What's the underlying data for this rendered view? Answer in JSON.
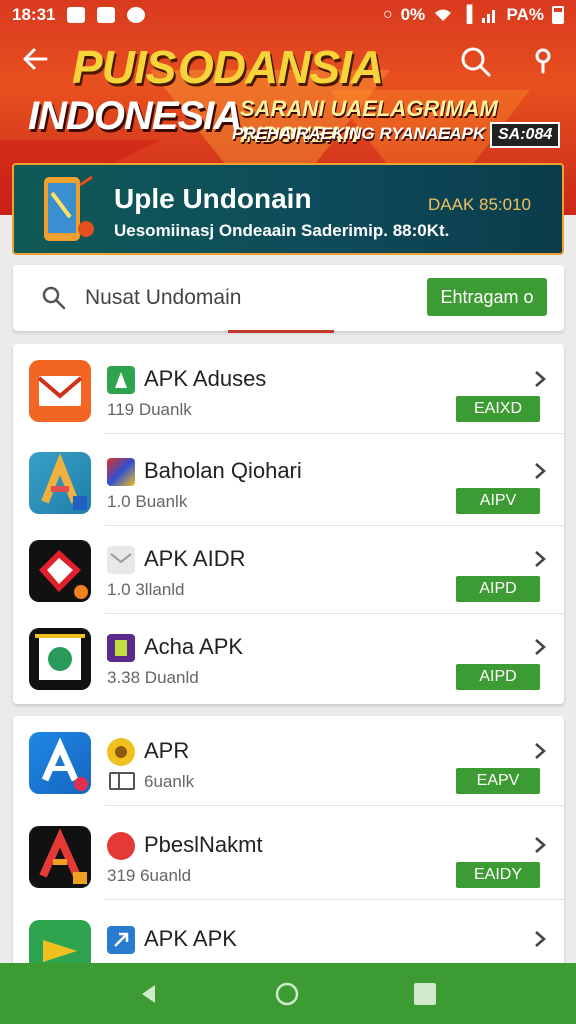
{
  "statusbar": {
    "time": "18:31",
    "right_text": "0%",
    "battery": "PA%"
  },
  "header": {
    "title_left": "PUIS",
    "title_right": "ODANSIA",
    "title_sub": "INDONESIA",
    "tagline_1": "SARANI UAELAGRIMAM INDONBAN",
    "tagline_2": "PREHAIRAEKING RYANAN",
    "tag_badge_1": "EAPK",
    "tag_badge_2": "SA:084"
  },
  "promo": {
    "title": "Uple Undonain",
    "description": "Uesomiinasj Ondeaain Saderimip. 88:0Kt.",
    "badge": "DAAK 85:010"
  },
  "search": {
    "placeholder": "Nusat Undomain",
    "button_label": "Ehtragam o"
  },
  "list1": [
    {
      "title": "APK Aduses",
      "subtitle": "119 Duanlk",
      "button": "EAIXD"
    },
    {
      "title": "Baholan Qiohari",
      "subtitle": "1.0 Buanlk",
      "button": "AIPV"
    },
    {
      "title": "APK AIDR",
      "subtitle": "1.0 3llanld",
      "button": "AIPD"
    },
    {
      "title": "Acha APK",
      "subtitle": "3.38 Duanld",
      "button": "AIPD"
    }
  ],
  "list2": [
    {
      "title": "APR",
      "subtitle": "6uanlk",
      "button": "EAPV"
    },
    {
      "title": "PbeslNakmt",
      "subtitle": "319 6uanld",
      "button": "EAIDY"
    },
    {
      "title": "APK APK",
      "subtitle": "",
      "button": ""
    }
  ],
  "colors": {
    "primary_green": "#3d9b33",
    "header_red": "#d93a1f",
    "title_yellow": "#f7d53a"
  }
}
